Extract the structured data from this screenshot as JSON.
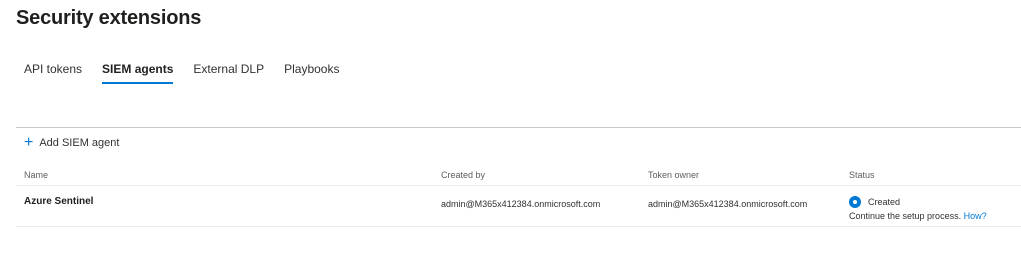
{
  "page": {
    "title": "Security extensions"
  },
  "tabs": [
    {
      "label": "API tokens",
      "active": false
    },
    {
      "label": "SIEM agents",
      "active": true
    },
    {
      "label": "External DLP",
      "active": false
    },
    {
      "label": "Playbooks",
      "active": false
    }
  ],
  "toolbar": {
    "add_icon": "plus-icon",
    "add_label": "Add SIEM agent"
  },
  "table": {
    "columns": [
      "Name",
      "Created by",
      "Token owner",
      "Status"
    ],
    "rows": [
      {
        "name": "Azure Sentinel",
        "created_by": "admin@M365x412384.onmicrosoft.com",
        "token_owner": "admin@M365x412384.onmicrosoft.com",
        "status": "Created",
        "status_note": "Continue the setup process.",
        "status_link": "How?"
      }
    ]
  },
  "colors": {
    "accent": "#0078d4",
    "divider": "#c8c6c4"
  }
}
